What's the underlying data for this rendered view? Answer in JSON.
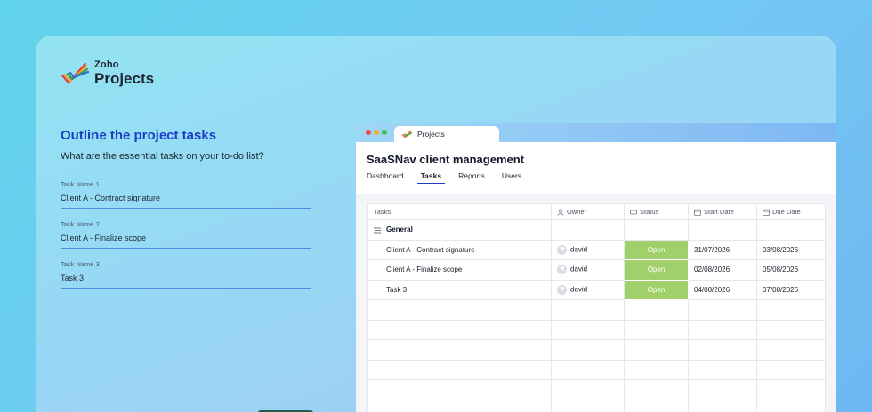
{
  "brand": {
    "line1": "Zoho",
    "line2": "Projects"
  },
  "form": {
    "title": "Outline the project tasks",
    "subtitle": "What are the essential tasks on your to-do list?",
    "fields": [
      {
        "label": "Task Name 1",
        "value": "Client A - Contract signature"
      },
      {
        "label": "Task Name 2",
        "value": "Client A - Finalize scope"
      },
      {
        "label": "Task Name 3",
        "value": "Task 3"
      }
    ]
  },
  "window": {
    "tab_label": "Projects",
    "project_title": "SaaSNav client management",
    "nav": [
      "Dashboard",
      "Tasks",
      "Reports",
      "Users"
    ],
    "active_nav": "Tasks"
  },
  "table": {
    "columns": [
      "Tasks",
      "Owner",
      "Status",
      "Start Date",
      "Due Date"
    ],
    "group": "General",
    "rows": [
      {
        "task": "Client A - Contract signature",
        "owner": "david",
        "status": "Open",
        "start": "31/07/2026",
        "due": "03/08/2026"
      },
      {
        "task": "Client A - Finalize scope",
        "owner": "david",
        "status": "Open",
        "start": "02/08/2026",
        "due": "05/08/2026"
      },
      {
        "task": "Task 3",
        "owner": "david",
        "status": "Open",
        "start": "04/08/2026",
        "due": "07/08/2026"
      }
    ]
  },
  "colors": {
    "accent": "#1b3ec8",
    "status_open": "#9fd06a",
    "field_underline": "#4a8fe0"
  },
  "icons": {
    "logo": "zoho-projects-check-icon",
    "owner_col": "person-icon",
    "status_col": "status-tag-icon",
    "date_col": "calendar-icon",
    "group": "list-icon",
    "avatar": "user-avatar-icon"
  }
}
